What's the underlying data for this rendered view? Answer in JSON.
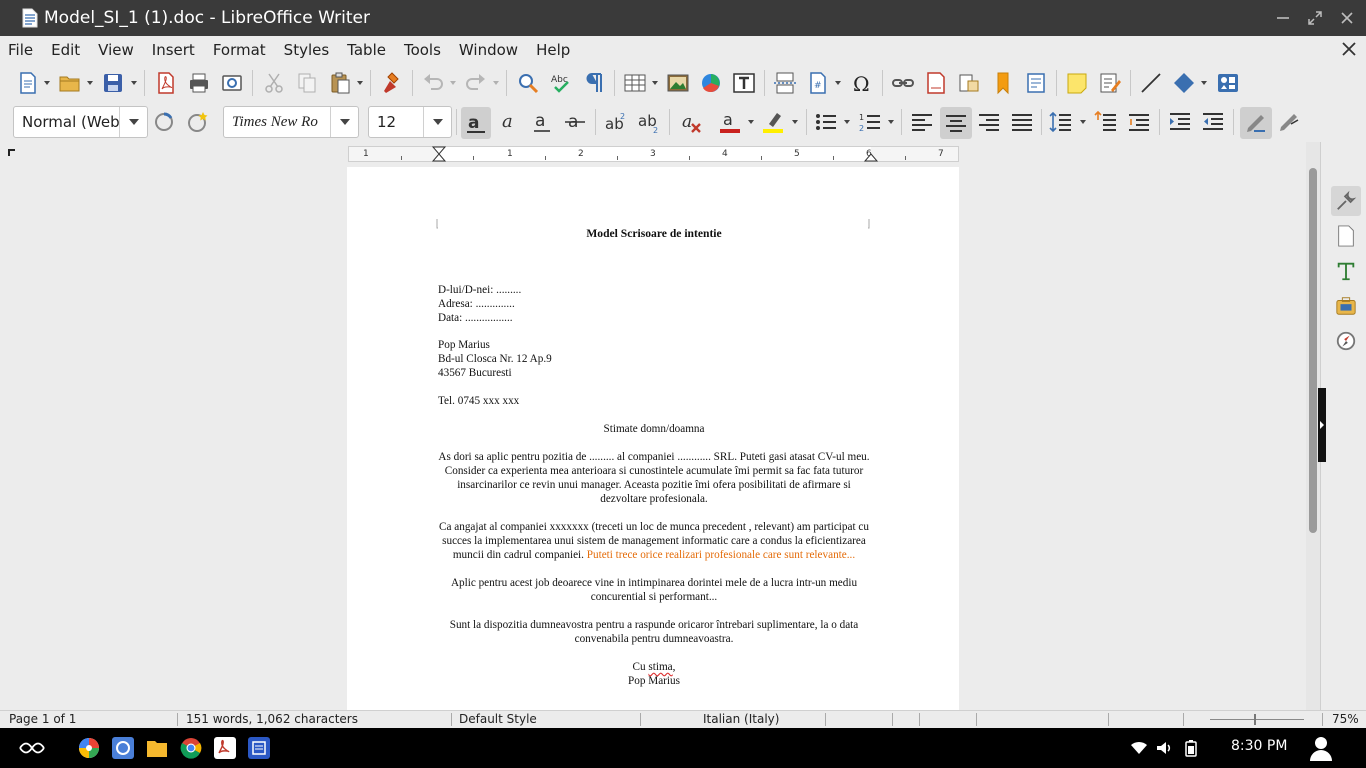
{
  "window": {
    "title": "Model_SI_1 (1).doc - LibreOffice Writer"
  },
  "menu": [
    "File",
    "Edit",
    "View",
    "Insert",
    "Format",
    "Styles",
    "Table",
    "Tools",
    "Window",
    "Help"
  ],
  "formatting": {
    "paragraph_style": "Normal (Web",
    "font_name": "Times New Ro",
    "font_size": "12"
  },
  "ruler": {
    "numbers": [
      "1",
      "1",
      "2",
      "3",
      "4",
      "5",
      "6",
      "7"
    ]
  },
  "document": {
    "title": "Model Scrisoare de intentie",
    "recipient": [
      "D-lui/D-nei: .........",
      "Adresa: ..............",
      "Data: ................."
    ],
    "sender": [
      "Pop Marius",
      "Bd-ul Closca Nr. 12 Ap.9",
      "43567 Bucuresti"
    ],
    "phone": "Tel. 0745 xxx xxx",
    "greeting": "Stimate domn/doamna",
    "para1": "As dori sa aplic pentru pozitia de ......... al companiei ............ SRL. Puteti gasi atasat CV-ul meu. Consider ca experienta mea anterioara si cunostintele acumulate îmi permit sa fac fata tuturor insarcinarilor ce revin unui manager. Aceasta pozitie îmi ofera posibilitati de afirmare si dezvoltare profesionala.",
    "para2": "Ca angajat al companiei xxxxxxx (treceti un loc de munca precedent , relevant) am participat cu succes la implementarea unui sistem de management informatic care a condus la eficientizarea muncii din cadrul companiei.",
    "para2_highlight": "Puteti trece orice realizari profesionale care sunt relevante...",
    "para3": "Aplic pentru acest job deoarece vine in intimpinarea dorintei mele de a lucra intr-un mediu concurential si performant...",
    "para4": "Sunt la dispozitia dumneavostra pentru a raspunde oricaror întrebari suplimentare, la o data convenabila pentru dumneavoastra.",
    "closing_prefix": "Cu ",
    "closing_word": "stima",
    "closing_suffix": ",",
    "signature": "Pop Marius"
  },
  "status": {
    "page": "Page 1 of 1",
    "words": "151 words, 1,062 characters",
    "page_style": "Default Style",
    "language": "Italian (Italy)",
    "zoom": "75%"
  },
  "taskbar": {
    "clock": "8:30 PM"
  },
  "colors": {
    "titlebar": "#3a3a3a",
    "highlight_text": "#e46c0a"
  }
}
